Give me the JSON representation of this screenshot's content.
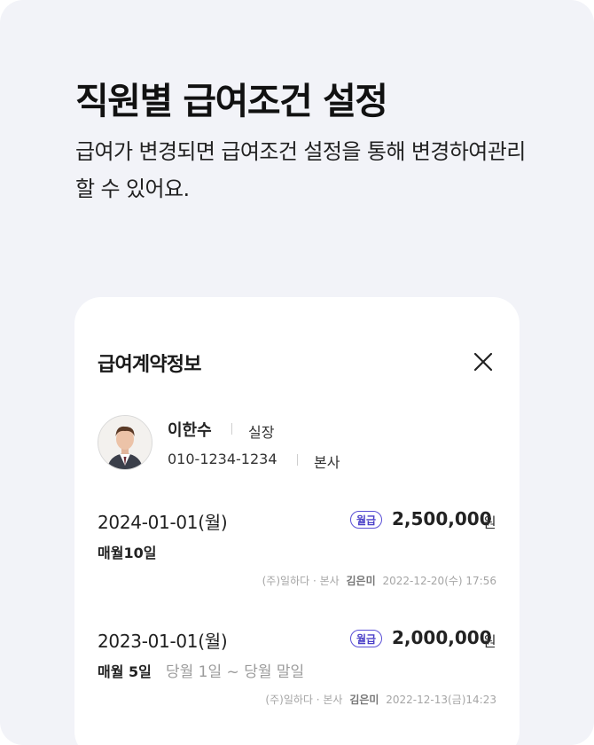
{
  "headline": "직원별 급여조건 설정",
  "subtitle": "급여가 변경되면 급여조건 설정을 통해 변경하여관리할 수 있어요.",
  "card": {
    "title": "급여계약정보",
    "close_icon": "close-icon",
    "employee": {
      "avatar_icon": "avatar",
      "name": "이한수",
      "position": "실장",
      "phone": "010-1234-1234",
      "department": "본사"
    },
    "records": [
      {
        "date": "2024-01-01(월)",
        "pay_type": "월급",
        "amount": "2,500,000",
        "unit": "원",
        "pay_day": "매월10일",
        "period": "",
        "company": "(주)일하다 · 본사",
        "editor": "김은미",
        "timestamp": "2022-12-20(수) 17:56"
      },
      {
        "date": "2023-01-01(월)",
        "pay_type": "월급",
        "amount": "2,000,000",
        "unit": "원",
        "pay_day": "매월 5일",
        "period": "당월 1일 ~ 당월 말일",
        "company": "(주)일하다 · 본사",
        "editor": "김은미",
        "timestamp": "2022-12-13(금)14:23"
      }
    ]
  },
  "colors": {
    "background": "#f2f3f8",
    "card": "#ffffff",
    "accent": "#5a4fd6"
  }
}
